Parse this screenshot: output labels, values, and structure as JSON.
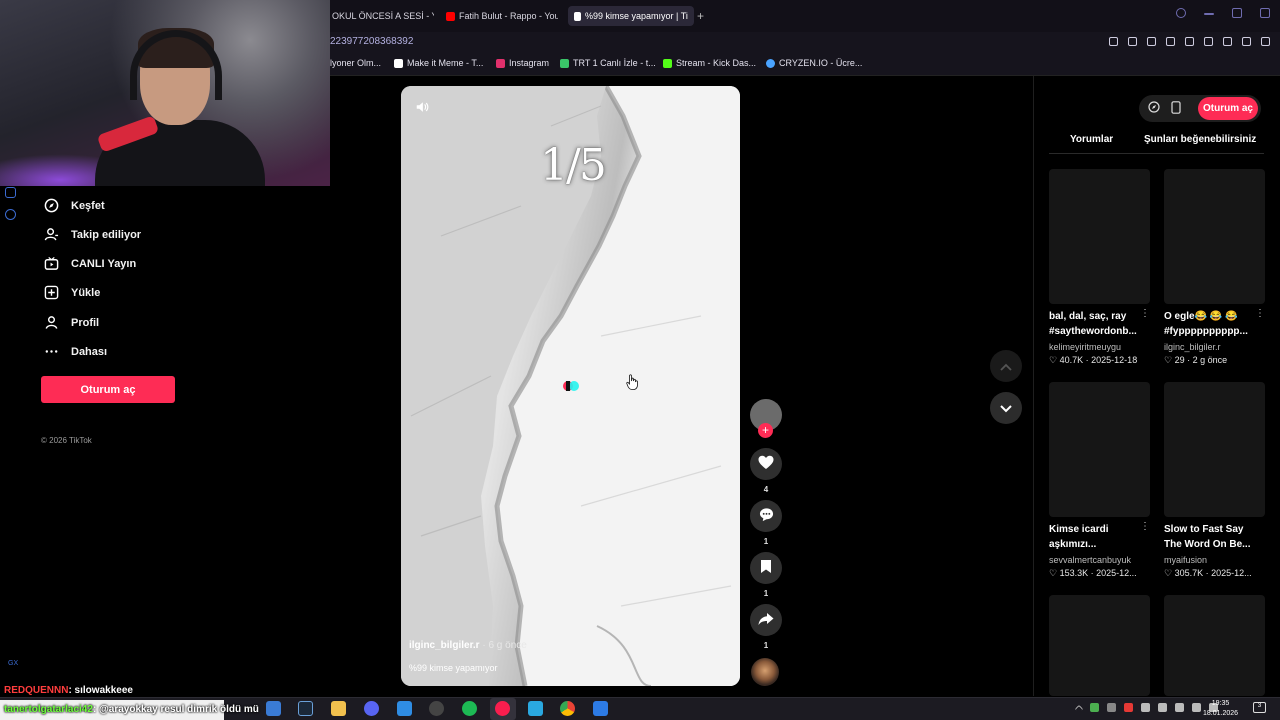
{
  "browser": {
    "tabs": [
      {
        "label": "OKUL ÖNCESİ A SESİ - Yo",
        "icon": "youtube-icon",
        "color": "#ff0000",
        "active": false
      },
      {
        "label": "Fatih Bulut - Rappo - YouT",
        "icon": "youtube-icon",
        "color": "#ff0000",
        "active": false
      },
      {
        "label": "%99 kimse yapamıyor | Ti",
        "icon": "tiktok-icon",
        "color": "#ffffff",
        "active": true
      }
    ],
    "url": "223977208368392",
    "bookmarks": [
      {
        "label": "lyoner Olm...",
        "color": "#2a6df4"
      },
      {
        "label": "Make it Meme - T...",
        "color": "#ffffff"
      },
      {
        "label": "Instagram",
        "color": "#e1306c"
      },
      {
        "label": "TRT 1 Canlı İzle - t...",
        "color": "#3ac569"
      },
      {
        "label": "Stream - Kick Das...",
        "color": "#53fc18"
      },
      {
        "label": "CRYZEN.IO - Ücre...",
        "color": "#4aa3ff"
      }
    ]
  },
  "sidebar": {
    "items": [
      {
        "label": "Keşfet",
        "icon": "compass-icon"
      },
      {
        "label": "Takip ediliyor",
        "icon": "user-follow-icon"
      },
      {
        "label": "CANLI Yayın",
        "icon": "live-tv-icon"
      },
      {
        "label": "Yükle",
        "icon": "upload-plus-icon"
      },
      {
        "label": "Profil",
        "icon": "profile-icon"
      },
      {
        "label": "Dahası",
        "icon": "more-dots-icon"
      }
    ],
    "login_label": "Oturum aç",
    "copyright": "© 2026 TikTok"
  },
  "video": {
    "counter": "1/5",
    "author": "ilginc_bilgiler.r",
    "posted": "· 6 g önce",
    "caption": "%99 kimse yapamıyor",
    "accent": "#fe2c55"
  },
  "actions": {
    "likes": "4",
    "comments": "1",
    "saves": "1",
    "shares": "1"
  },
  "right_panel": {
    "login_label": "Oturum aç",
    "tabs": [
      "Yorumlar",
      "Şunları beğenebilirsiniz"
    ],
    "cards": [
      {
        "title1": "bal, dal, saç, ray",
        "title2": "#saythewordonb...",
        "user": "kelimeyiritmeuygu",
        "likes": "40.7K",
        "date": "2025-12-18"
      },
      {
        "title1": "O egle😂 😂 😂",
        "title2": "#fypppppppppp...",
        "user": "ilginc_bilgiler.r",
        "likes": "29",
        "date": "2 g önce"
      },
      {
        "title1": "Kimse icardi",
        "title2": "aşkımızı...",
        "user": "sevvalmertcanbuyuk",
        "likes": "153.3K",
        "date": "2025-12..."
      },
      {
        "title1": "Slow to Fast Say",
        "title2": "The Word On Be...",
        "user": "myaifusion",
        "likes": "305.7K",
        "date": "2025-12..."
      }
    ]
  },
  "chat": [
    {
      "user": "REDQUENNN",
      "message": ": sılowakkeee"
    },
    {
      "user": "tanertolgatarlaci42",
      "message": ": @arayokkay resul dimrik öldü mü"
    }
  ],
  "taskbar": {
    "time": "19:35",
    "date": "18.01.2026",
    "notifications": "3",
    "apps": [
      {
        "name": "app-1-icon",
        "color": "#3a7bd5"
      },
      {
        "name": "steam-icon",
        "color": "#1b2838"
      },
      {
        "name": "file-explorer-icon",
        "color": "#f2c14e"
      },
      {
        "name": "discord-icon",
        "color": "#5865f2"
      },
      {
        "name": "app-5-icon",
        "color": "#2f8de4"
      },
      {
        "name": "app-6-icon",
        "color": "#444444"
      },
      {
        "name": "spotify-icon",
        "color": "#1db954"
      },
      {
        "name": "opera-gx-icon",
        "color": "#fa1e4e"
      },
      {
        "name": "app-9-icon",
        "color": "#2aa8e0"
      },
      {
        "name": "chrome-icon",
        "color": "#ea4335"
      },
      {
        "name": "app-11-icon",
        "color": "#2d7be5"
      }
    ]
  }
}
